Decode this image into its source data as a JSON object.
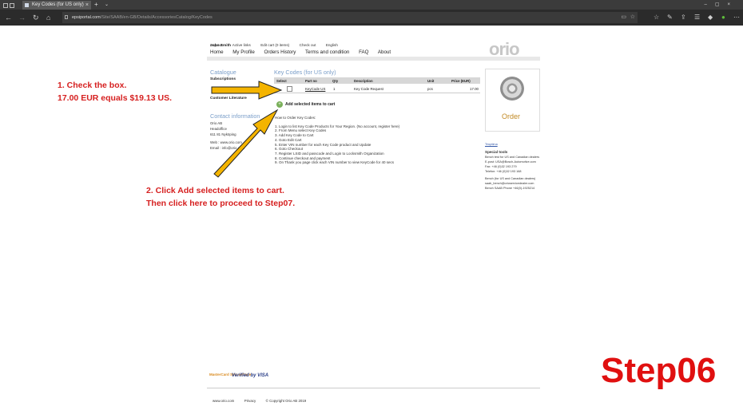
{
  "browser": {
    "tab_title": "Key Codes (for US only)",
    "address_domain": "epsiportal.com",
    "address_path": "/Site/SAAB/en-GB/Details/AccessoriesCatalog/KeyCodes"
  },
  "header": {
    "top_links": [
      "Log out",
      "Active links",
      "Edit cart (0 items)",
      "Check out",
      "English"
    ],
    "user_name": "John Smith",
    "nav": [
      "Home",
      "My Profile",
      "Orders History",
      "Terms and condition",
      "FAQ",
      "About"
    ],
    "logo": "orio"
  },
  "sidebar": {
    "catalogue_title": "Catalogue",
    "subscriptions": "Subscriptions",
    "customer_literature": "Customer Literature",
    "contact_title": "Contact information",
    "contact_lines": [
      "Orio AB",
      "Headoffice",
      "611 81 Nyköping"
    ],
    "web_label": "Web : www.orio.com",
    "email_label": "Email : info@orio.com"
  },
  "main": {
    "title": "Key Codes (for US only)",
    "columns": [
      "Select",
      "Part no",
      "Qty",
      "Description",
      "Unit",
      "Price (EUR)"
    ],
    "row": {
      "part_no": "KeyCode US",
      "qty": "1",
      "description": "Key Code Request",
      "unit": "pcs",
      "price": "17.00"
    },
    "add_button": "Add selected items to cart",
    "how_to_title": "How to Order Key Codes:",
    "steps": [
      "1. Login to list Key Code Products for Your Region. (No account, register here)",
      "2. From Menu select Key Codes",
      "3. Add Key Code to Cart",
      "4. Goto Edit Cart",
      "5. Enter VIN number for each Key Code product and Update",
      "6. Goto Checkout",
      "7. Register LSID and passcode and Login to Locksmith Organization",
      "8. Continue checkout and payment",
      "9. On Thank you page click each VIN number to view KeyCode for 40 secs"
    ]
  },
  "right": {
    "order_label": "Order",
    "trioptima": "Trioptima",
    "special_tools_title": "Special tools",
    "lines": [
      "Bench test for US and Canadian dealers",
      "E-post: USA@Bosch-Automotive.com",
      "Fax: +46 (0)32 193 279",
      "Telefon: +46 (0)32 193 168",
      "Bench (for US and Canadian dealers)",
      "saab_bench@orioservicedealer.com",
      "Bench SAAB Phone +46(0)-1925214"
    ]
  },
  "footer": {
    "links": [
      "www.orio.com",
      "Privacy",
      "© Copyright Orio AB 2019"
    ],
    "mastercard": "MasterCard SecureCode",
    "visa": "Verified by VISA"
  },
  "annotations": {
    "note1_line1": "1. Check the box.",
    "note1_line2": "17.00 EUR equals $19.13 US.",
    "note2_line1": "2. Click Add selected items to cart.",
    "note2_line2": "Then click here to proceed to Step07.",
    "step_label": "Step06",
    "arrow_color": "#f4b400",
    "label_color": "#e01010"
  }
}
